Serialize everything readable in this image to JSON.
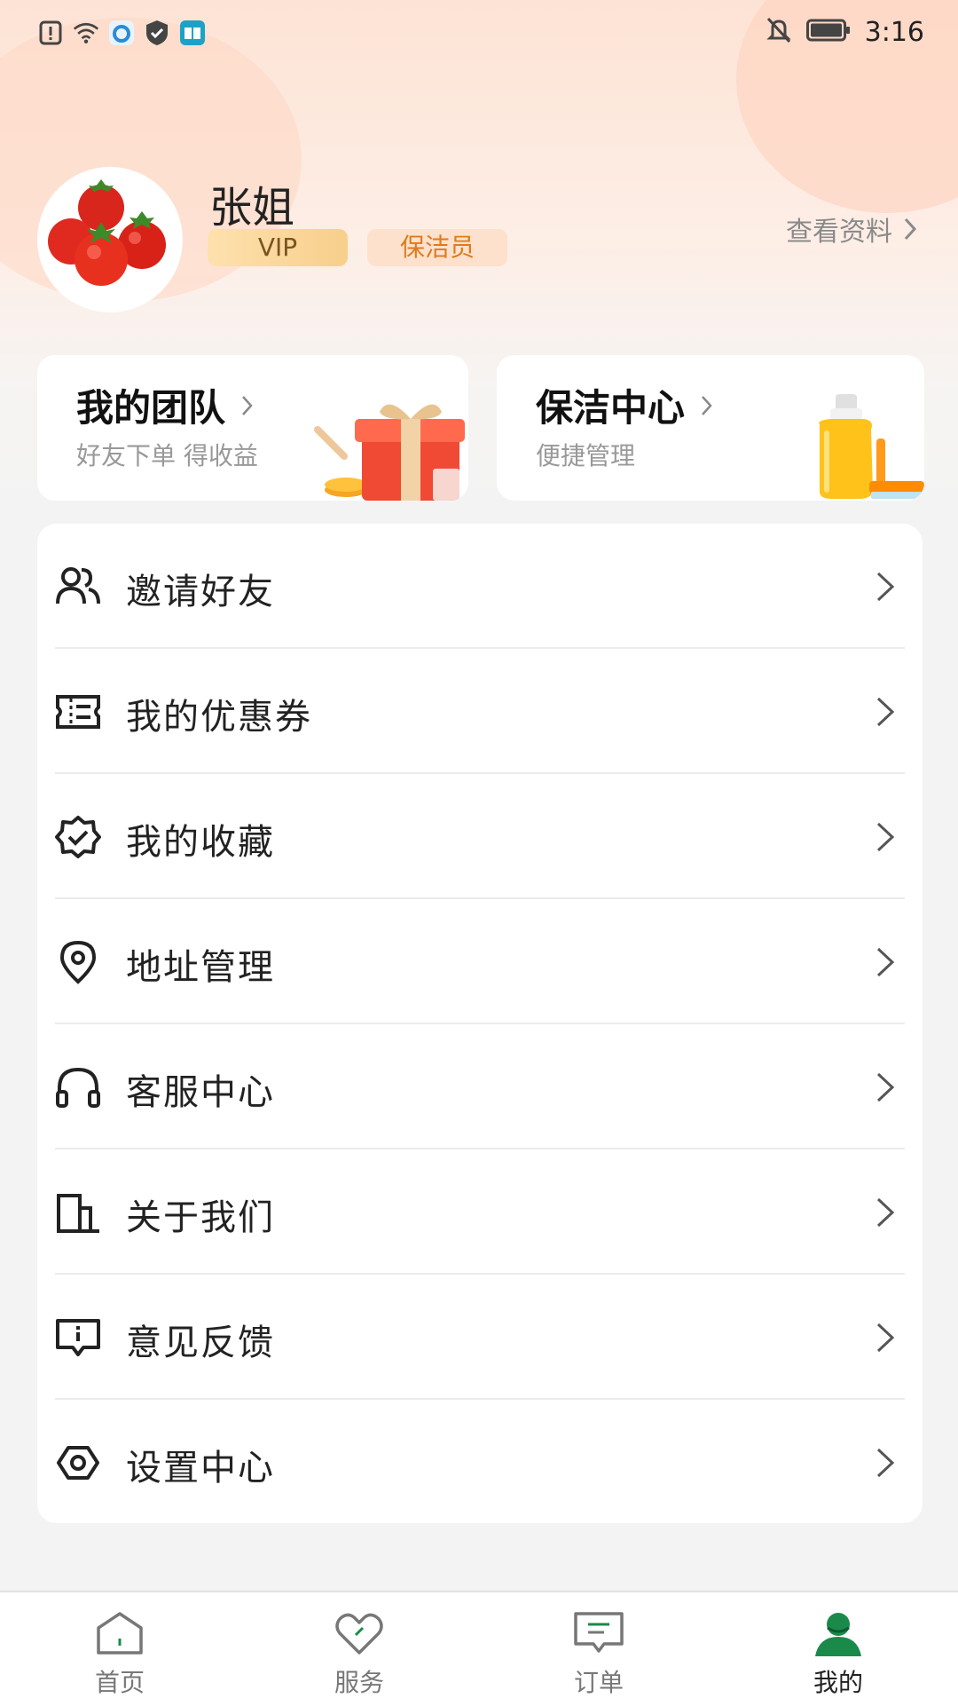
{
  "status_bar": {
    "time": "3:16",
    "icons": [
      "alert-icon",
      "wifi-icon",
      "browser-app-icon",
      "shield-icon",
      "book-app-icon"
    ],
    "right_icons": [
      "mute-bell-icon",
      "battery-icon"
    ]
  },
  "profile": {
    "name": "张姐",
    "badges": [
      "VIP",
      "保洁员"
    ],
    "view_profile": "查看资料"
  },
  "feature_cards": [
    {
      "title": "我的团队",
      "subtitle": "好友下单 得收益",
      "art": "gift-box-illustration"
    },
    {
      "title": "保洁中心",
      "subtitle": "便捷管理",
      "art": "cleaning-supplies-illustration"
    }
  ],
  "menu": [
    {
      "label": "邀请好友",
      "icon": "users-icon"
    },
    {
      "label": "我的优惠券",
      "icon": "coupon-icon"
    },
    {
      "label": "我的收藏",
      "icon": "badge-check-icon"
    },
    {
      "label": "地址管理",
      "icon": "location-pin-icon"
    },
    {
      "label": "客服中心",
      "icon": "headset-icon"
    },
    {
      "label": "关于我们",
      "icon": "building-icon"
    },
    {
      "label": "意见反馈",
      "icon": "feedback-icon"
    },
    {
      "label": "设置中心",
      "icon": "settings-icon"
    }
  ],
  "tab_bar": {
    "tabs": [
      {
        "label": "首页",
        "icon": "home-icon"
      },
      {
        "label": "服务",
        "icon": "heart-icon"
      },
      {
        "label": "订单",
        "icon": "message-icon"
      },
      {
        "label": "我的",
        "icon": "profile-icon"
      }
    ],
    "active_index": 3
  },
  "colors": {
    "accent_green": "#1a8a4a",
    "vip_gold": "#f8cf8c",
    "role_orange": "#e07a1c",
    "header_peach": "#fde3d5"
  }
}
